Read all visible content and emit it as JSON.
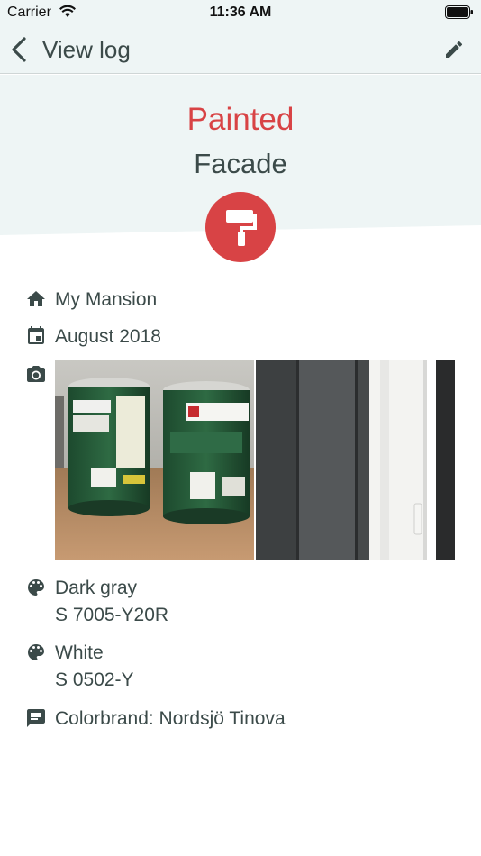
{
  "status_bar": {
    "carrier": "Carrier",
    "time": "11:36 AM"
  },
  "nav": {
    "back_label": "View log",
    "edit_icon": "pencil-icon"
  },
  "header": {
    "action": "Painted",
    "object": "Facade",
    "badge_icon": "paint-roller-icon"
  },
  "details": {
    "home": {
      "icon": "home-icon",
      "label": "My Mansion"
    },
    "date": {
      "icon": "calendar-icon",
      "label": "August 2018"
    },
    "photos": {
      "icon": "camera-icon",
      "items": [
        "paint-cans-photo",
        "facade-wall-photo"
      ]
    },
    "colors": [
      {
        "icon": "palette-icon",
        "name": "Dark gray",
        "code": "S 7005-Y20R"
      },
      {
        "icon": "palette-icon",
        "name": "White",
        "code": "S 0502-Y"
      }
    ],
    "note": {
      "icon": "comment-icon",
      "text": "Colorbrand: Nordsjö Tinova"
    }
  },
  "colors_theme": {
    "accent": "#d84345",
    "text": "#3b4a49",
    "header_bg": "#eef5f5"
  }
}
